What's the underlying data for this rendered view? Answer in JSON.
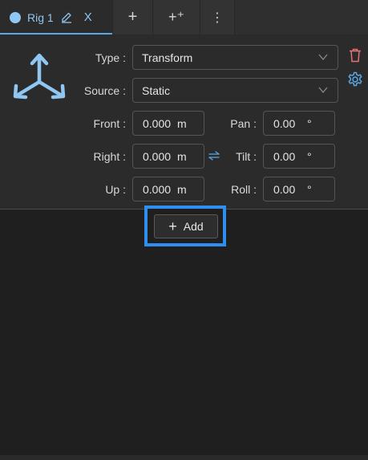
{
  "tabs": {
    "rig": {
      "label": "Rig 1",
      "close": "X"
    },
    "add": "+",
    "add_plus": "+⁺",
    "more": "⋮"
  },
  "icons": {
    "rig_dot": "filled-circle-icon",
    "edit": "pencil-icon",
    "logo": "axes-tripod-icon",
    "delete": "trash-icon",
    "settings": "gear-icon",
    "swap": "swap-arrows-icon",
    "chevron": "chevron-down-icon"
  },
  "form": {
    "type_label": "Type :",
    "type_value": "Transform",
    "source_label": "Source :",
    "source_value": "Static",
    "front_label": "Front :",
    "front_value": "0.000",
    "front_unit": "m",
    "right_label": "Right :",
    "right_value": "0.000",
    "right_unit": "m",
    "up_label": "Up :",
    "up_value": "0.000",
    "up_unit": "m",
    "pan_label": "Pan :",
    "pan_value": "0.00",
    "pan_unit": "°",
    "tilt_label": "Tilt :",
    "tilt_value": "0.00",
    "tilt_unit": "°",
    "roll_label": "Roll :",
    "roll_value": "0.00",
    "roll_unit": "°"
  },
  "actions": {
    "add_label": "Add",
    "add_icon": "+"
  },
  "colors": {
    "accent": "#8fc6f2",
    "highlight": "#2e8ff0",
    "delete": "#e57373"
  }
}
